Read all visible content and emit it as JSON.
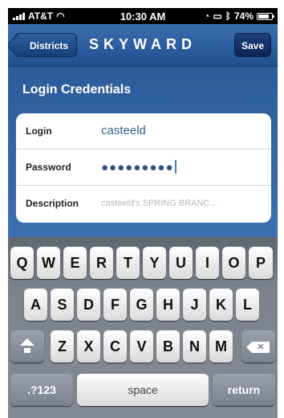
{
  "status_bar": {
    "carrier": "AT&T",
    "time": "10:30 AM",
    "battery_percent": "74%",
    "icons": [
      "signal-icon",
      "wifi-icon",
      "alarm-icon",
      "lock-icon",
      "bluetooth-icon",
      "battery-icon"
    ]
  },
  "nav": {
    "back_label": "Districts",
    "logo": "SKYWARD",
    "save_label": "Save"
  },
  "section": {
    "title": "Login Credentials"
  },
  "form": {
    "login": {
      "label": "Login",
      "value": "casteeld"
    },
    "password": {
      "label": "Password",
      "value": "●●●●●●●●●"
    },
    "description": {
      "label": "Description",
      "placeholder": "casteeld's SPRING BRANC..."
    }
  },
  "keyboard": {
    "row1": [
      "Q",
      "W",
      "E",
      "R",
      "T",
      "Y",
      "U",
      "I",
      "O",
      "P"
    ],
    "row2": [
      "A",
      "S",
      "D",
      "F",
      "G",
      "H",
      "J",
      "K",
      "L"
    ],
    "row3": [
      "Z",
      "X",
      "C",
      "V",
      "B",
      "N",
      "M"
    ],
    "numbers_label": ".?123",
    "space_label": "space",
    "return_label": "return"
  },
  "colors": {
    "nav_blue": "#2a5a98",
    "label_text": "#222222",
    "value_text": "#3a5b8c"
  }
}
